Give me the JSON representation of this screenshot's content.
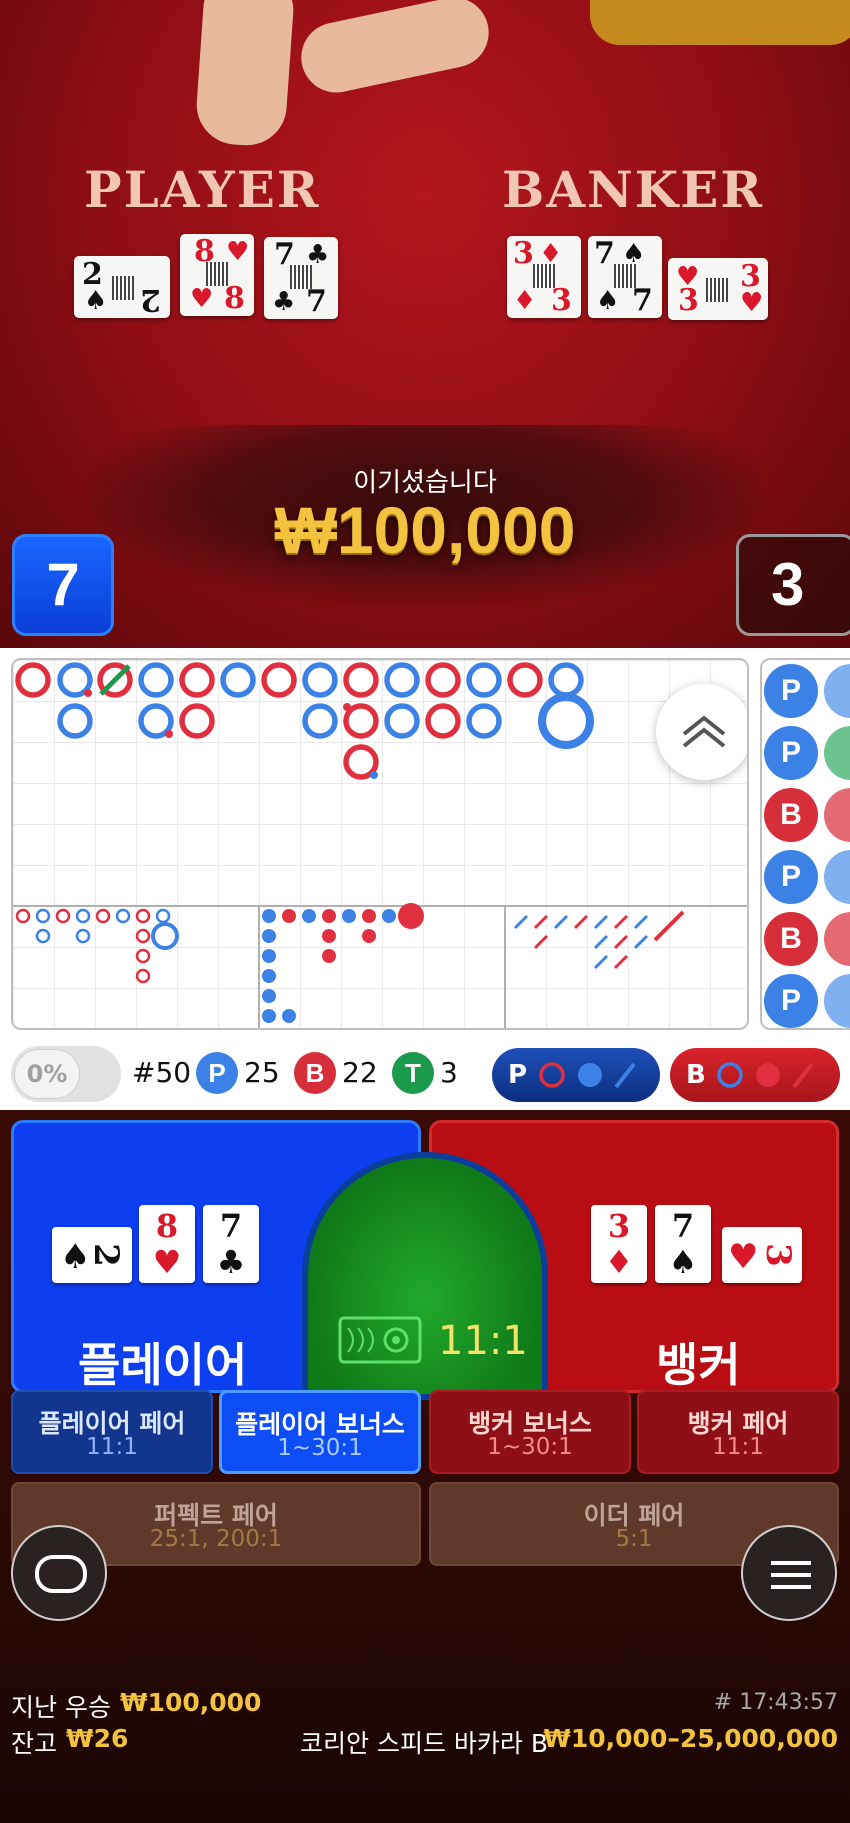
{
  "table": {
    "player_label": "PLAYER",
    "banker_label": "BANKER"
  },
  "dealt_cards": {
    "player": [
      {
        "rank": "2",
        "suit": "♠",
        "color": "black"
      },
      {
        "rank": "8",
        "suit": "♥",
        "color": "red"
      },
      {
        "rank": "7",
        "suit": "♣",
        "color": "black"
      }
    ],
    "banker": [
      {
        "rank": "3",
        "suit": "♦",
        "color": "red"
      },
      {
        "rank": "7",
        "suit": "♠",
        "color": "black"
      },
      {
        "rank": "3",
        "suit": "♥",
        "color": "red"
      }
    ]
  },
  "result": {
    "title": "이기셨습니다",
    "amount": "₩100,000",
    "player_score": "7",
    "banker_score": "3"
  },
  "roadmap": {
    "bead_labels": [
      "P",
      "P",
      "B",
      "P",
      "B",
      "P"
    ],
    "percent_toggle": "0%",
    "stats": {
      "round": "#50",
      "p_label": "P",
      "p_count": "25",
      "b_label": "B",
      "b_count": "22",
      "t_label": "T",
      "t_count": "3"
    },
    "predict_player": "P",
    "predict_banker": "B",
    "colors": {
      "player": "#3c82e6",
      "banker": "#d62f3a",
      "tie": "#1a9a4a"
    }
  },
  "bets": {
    "player": "플레이어",
    "banker": "뱅커",
    "tie_odds": "11:1",
    "side": [
      {
        "name": "플레이어 페어",
        "odds": "11:1"
      },
      {
        "name": "플레이어 보너스",
        "odds": "1~30:1"
      },
      {
        "name": "뱅커 보너스",
        "odds": "1~30:1"
      },
      {
        "name": "뱅커 페어",
        "odds": "11:1"
      }
    ],
    "perfect_pair": {
      "name": "퍼펙트 페어",
      "odds": "25:1, 200:1"
    },
    "either_pair": {
      "name": "이더 페어",
      "odds": "5:1"
    }
  },
  "footer": {
    "last_win_label": "지난 우승",
    "last_win_amount": "₩100,000",
    "balance_label": "잔고",
    "balance_amount": "₩26",
    "round_id": "# 17:43:57",
    "table_name": "코리안 스피드 바카라 B",
    "limits": "₩10,000–25,000,000"
  }
}
